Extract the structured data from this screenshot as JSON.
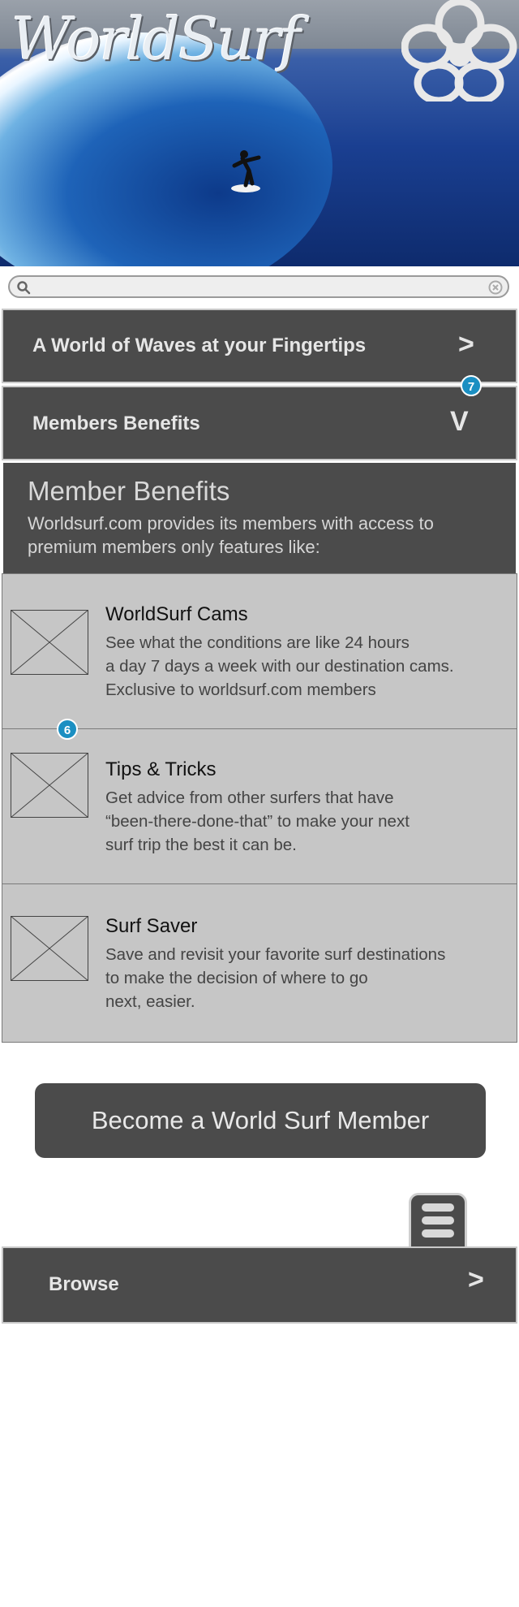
{
  "header": {
    "logo_text": "WorldSurf"
  },
  "search": {
    "placeholder": ""
  },
  "nav": {
    "fingertips_label": "A World of Waves at your Fingertips",
    "fingertips_chevron": ">",
    "members_label": "Members Benefits",
    "members_chevron": "V",
    "members_badge": "7"
  },
  "benefits": {
    "title": "Member Benefits",
    "description": "Worldsurf.com provides its members with access to premium members only features like:",
    "badge": "6",
    "items": [
      {
        "title": "WorldSurf Cams",
        "lines": [
          "See what the conditions are like 24 hours",
          "a day 7 days a week with our destination cams.",
          "Exclusive to worldsurf.com members"
        ]
      },
      {
        "title": "Tips & Tricks",
        "lines": [
          "Get advice from other surfers that have",
          "“been-there-done-that” to make your next",
          "surf trip the best it can be."
        ]
      },
      {
        "title": "Surf Saver",
        "lines": [
          "Save and revisit your favorite surf destinations",
          "to make the decision of where to go",
          "next, easier."
        ]
      }
    ]
  },
  "cta": {
    "label": "Become a World Surf Member"
  },
  "browse": {
    "label": "Browse",
    "chevron": ">"
  },
  "colors": {
    "bar": "#4b4b4b",
    "item_bg": "#c6c6c6",
    "badge": "#1b8fc2"
  },
  "icons": {
    "search": "search-icon",
    "clear": "clear-icon",
    "menu": "menu-icon",
    "flower": "hibiscus-icon"
  }
}
